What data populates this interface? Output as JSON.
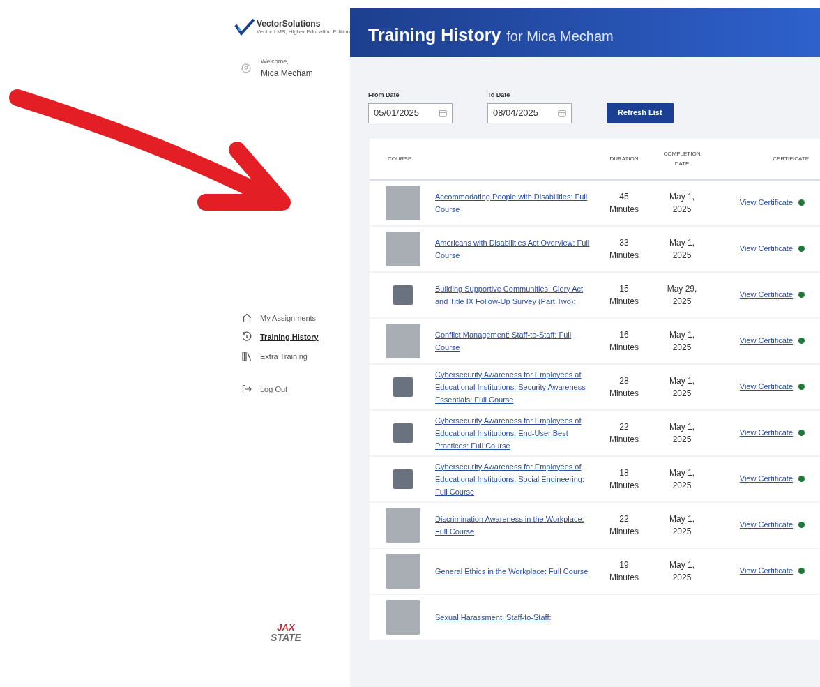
{
  "logo": {
    "name": "VectorSolutions",
    "tagline": "Vector LMS, Higher Education Edition"
  },
  "welcome": {
    "greeting": "Welcome,",
    "user": "Mica Mecham"
  },
  "nav": [
    {
      "kind": "home",
      "label": "My Assignments",
      "selected": false
    },
    {
      "kind": "history",
      "label": "Training History",
      "selected": true
    },
    {
      "kind": "library",
      "label": "Extra Training",
      "selected": false
    }
  ],
  "logout": {
    "label": "Log Out"
  },
  "school_logo": {
    "top": "JAX",
    "bottom": "STATE"
  },
  "header": {
    "title": "Training History",
    "subtitle": "for Mica Mecham"
  },
  "filters": {
    "from": {
      "label": "From Date",
      "value": "05/01/2025"
    },
    "to": {
      "label": "To Date",
      "value": "08/04/2025"
    },
    "button": "Refresh List"
  },
  "table": {
    "columns": [
      "COURSE",
      "DURATION",
      "COMPLETION DATE",
      "CERTIFICATE"
    ],
    "rows": [
      {
        "title": "Accommodating People with Disabilities: Full Course",
        "duration": [
          "45",
          "Minutes"
        ],
        "date": [
          "May 1,",
          "2025"
        ],
        "certificate": "View Certificate",
        "completed": true,
        "large_thumb": true
      },
      {
        "title": "Americans with Disabilities Act Overview: Full Course",
        "duration": [
          "33",
          "Minutes"
        ],
        "date": [
          "May 1,",
          "2025"
        ],
        "certificate": "View Certificate",
        "completed": true,
        "large_thumb": true
      },
      {
        "title": "Building Supportive Communities: Clery Act and Title IX Follow-Up Survey (Part Two):",
        "duration": [
          "15",
          "Minutes"
        ],
        "date": [
          "May 29,",
          "2025"
        ],
        "certificate": "View Certificate",
        "completed": true,
        "large_thumb": false
      },
      {
        "title": "Conflict Management: Staff-to-Staff: Full Course",
        "duration": [
          "16",
          "Minutes"
        ],
        "date": [
          "May 1,",
          "2025"
        ],
        "certificate": "View Certificate",
        "completed": true,
        "large_thumb": true
      },
      {
        "title": "Cybersecurity Awareness for Employees at Educational Institutions: Security Awareness Essentials: Full Course",
        "duration": [
          "28",
          "Minutes"
        ],
        "date": [
          "May 1,",
          "2025"
        ],
        "certificate": "View Certificate",
        "completed": true,
        "large_thumb": false
      },
      {
        "title": "Cybersecurity Awareness for Employees of Educational Institutions: End-User Best Practices: Full Course",
        "duration": [
          "22",
          "Minutes"
        ],
        "date": [
          "May 1,",
          "2025"
        ],
        "certificate": "View Certificate",
        "completed": true,
        "large_thumb": false
      },
      {
        "title": "Cybersecurity Awareness for Employees of Educational Institutions: Social Engineering: Full Course",
        "duration": [
          "18",
          "Minutes"
        ],
        "date": [
          "May 1,",
          "2025"
        ],
        "certificate": "View Certificate",
        "completed": true,
        "large_thumb": false
      },
      {
        "title": "Discrimination Awareness in the Workplace: Full Course",
        "duration": [
          "22",
          "Minutes"
        ],
        "date": [
          "May 1,",
          "2025"
        ],
        "certificate": "View Certificate",
        "completed": true,
        "large_thumb": true
      },
      {
        "title": "General Ethics in the Workplace: Full Course",
        "duration": [
          "19",
          "Minutes"
        ],
        "date": [
          "May 1,",
          "2025"
        ],
        "certificate": "View Certificate",
        "completed": true,
        "large_thumb": true
      },
      {
        "title": "Sexual Harassment: Staff-to-Staff:",
        "large_thumb": true
      }
    ]
  }
}
